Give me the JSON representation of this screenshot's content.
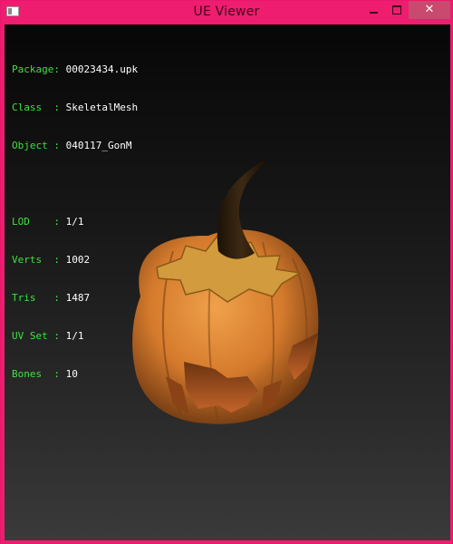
{
  "window": {
    "title": "UE Viewer",
    "icon": "app-icon",
    "controls": {
      "minimize_icon": "minimize-icon",
      "maximize_icon": "maximize-icon",
      "close_symbol": "✕"
    },
    "accent_color": "#ee1d6f"
  },
  "info": {
    "package": {
      "label": "Package:",
      "value": "00023434.upk"
    },
    "class": {
      "label": "Class  :",
      "value": "SkeletalMesh"
    },
    "object": {
      "label": "Object :",
      "value": "040117_GonM"
    },
    "lod": {
      "label": "LOD    :",
      "value": "1/1"
    },
    "verts": {
      "label": "Verts  :",
      "value": "1002"
    },
    "tris": {
      "label": "Tris   :",
      "value": "1487"
    },
    "uvset": {
      "label": "UV Set :",
      "value": "1/1"
    },
    "bones": {
      "label": "Bones  :",
      "value": "10"
    },
    "label_color": "#3fe03f",
    "value_color": "#ffffff"
  },
  "viewport": {
    "model_icon": "pumpkin-model"
  }
}
